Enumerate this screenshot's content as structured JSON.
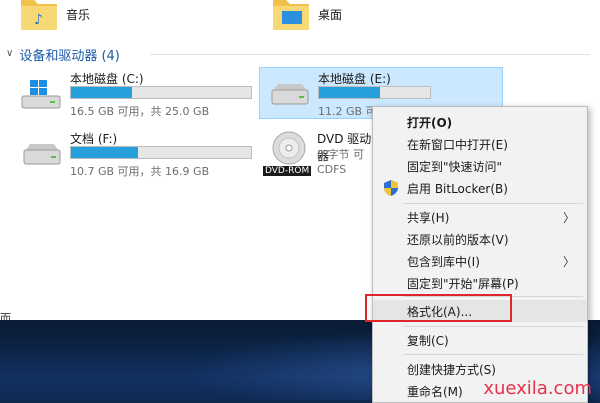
{
  "folders": [
    {
      "label": "音乐",
      "icon": "music-folder-icon"
    },
    {
      "label": "桌面",
      "icon": "desktop-folder-icon"
    }
  ],
  "section": {
    "title": "设备和驱动器 (4)"
  },
  "drives": [
    {
      "name": "本地磁盘 (C:)",
      "info": "16.5 GB 可用，共 25.0 GB",
      "used_fraction": 0.34,
      "icon": "windows-drive-icon"
    },
    {
      "name": "本地磁盘 (E:)",
      "info": "11.2 GB 可",
      "used_fraction": 0.55,
      "icon": "hard-drive-icon",
      "selected": true
    },
    {
      "name": "文档 (F:)",
      "info": "10.7 GB 可用，共 16.9 GB",
      "used_fraction": 0.37,
      "icon": "hard-drive-icon"
    },
    {
      "name": "DVD 驱动器",
      "info": "0 字节 可",
      "fs": "CDFS",
      "icon": "dvd-icon",
      "badge": "DVD-ROM"
    }
  ],
  "context_menu": {
    "open": "打开(O)",
    "open_new_window": "在新窗口中打开(E)",
    "pin_quick_access": "固定到\"快速访问\"",
    "bitlocker": "启用 BitLocker(B)",
    "share": "共享(H)",
    "restore_versions": "还原以前的版本(V)",
    "include_library": "包含到库中(I)",
    "pin_start": "固定到\"开始\"屏幕(P)",
    "format": "格式化(A)...",
    "copy": "复制(C)",
    "create_shortcut": "创建快捷方式(S)",
    "rename": "重命名(M)"
  },
  "edge_mark": "而",
  "watermark": "xuexila.com",
  "colors": {
    "accent": "#1e5aa8",
    "bar_fill": "#26a0da",
    "selection": "#cce8ff",
    "highlight_border": "#e0262b",
    "watermark": "#e8304c"
  }
}
